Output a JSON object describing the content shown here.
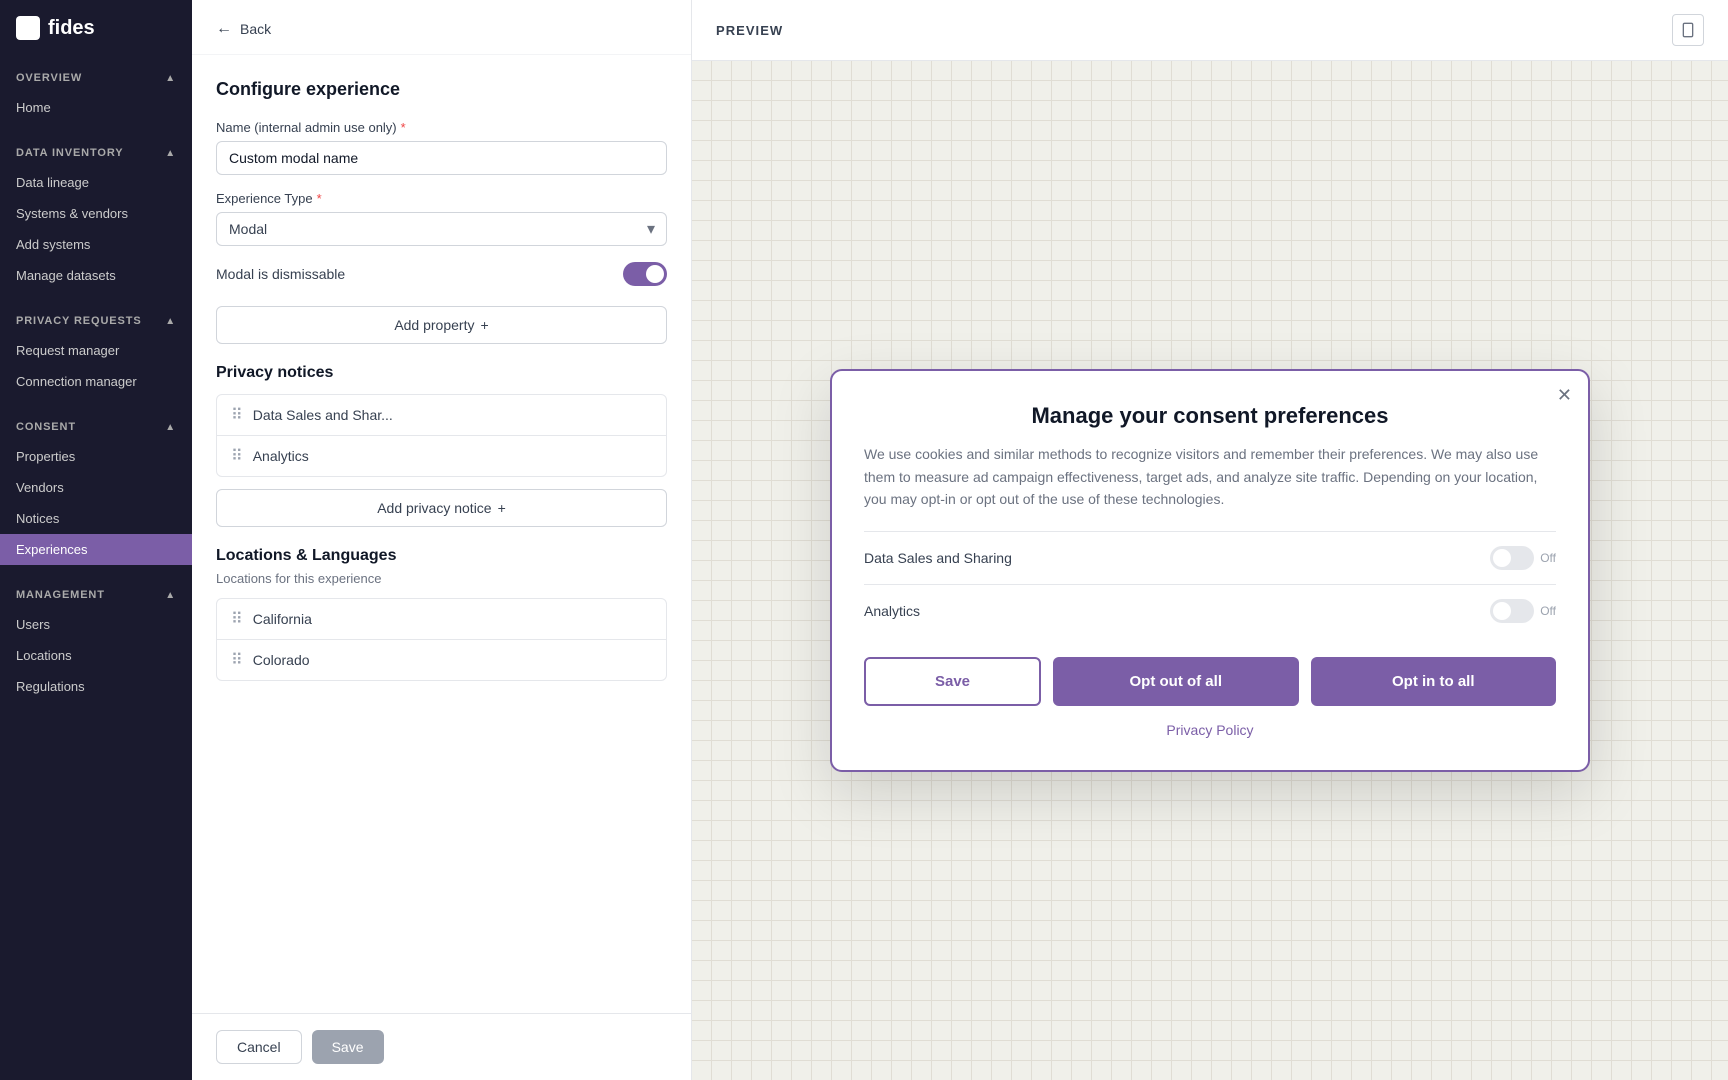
{
  "app": {
    "logo_text": "fides"
  },
  "sidebar": {
    "sections": [
      {
        "id": "overview",
        "label": "OVERVIEW",
        "items": [
          {
            "id": "home",
            "label": "Home",
            "active": false
          }
        ]
      },
      {
        "id": "data_inventory",
        "label": "DATA INVENTORY",
        "items": [
          {
            "id": "data_lineage",
            "label": "Data lineage",
            "active": false
          },
          {
            "id": "systems_vendors",
            "label": "Systems & vendors",
            "active": false
          },
          {
            "id": "add_systems",
            "label": "Add systems",
            "active": false
          },
          {
            "id": "manage_datasets",
            "label": "Manage datasets",
            "active": false
          }
        ]
      },
      {
        "id": "privacy_requests",
        "label": "PRIVACY REQUESTS",
        "items": [
          {
            "id": "request_manager",
            "label": "Request manager",
            "active": false
          },
          {
            "id": "connection_manager",
            "label": "Connection manager",
            "active": false
          }
        ]
      },
      {
        "id": "consent",
        "label": "CONSENT",
        "items": [
          {
            "id": "properties",
            "label": "Properties",
            "active": false
          },
          {
            "id": "vendors",
            "label": "Vendors",
            "active": false
          },
          {
            "id": "notices",
            "label": "Notices",
            "active": false
          },
          {
            "id": "experiences",
            "label": "Experiences",
            "active": true
          }
        ]
      },
      {
        "id": "management",
        "label": "MANAGEMENT",
        "items": [
          {
            "id": "users",
            "label": "Users",
            "active": false
          },
          {
            "id": "locations",
            "label": "Locations",
            "active": false
          },
          {
            "id": "regulations",
            "label": "Regulations",
            "active": false
          }
        ]
      }
    ]
  },
  "config": {
    "back_label": "Back",
    "section_title": "Configure experience",
    "name_label": "Name (internal admin use only)",
    "name_value": "Custom modal name",
    "experience_type_label": "Experience Type",
    "experience_type_value": "Modal",
    "modal_dismissable_label": "Modal is dismissable",
    "add_property_label": "Add property",
    "privacy_notices_title": "Privacy notices",
    "notices": [
      {
        "id": "data_sales",
        "label": "Data Sales and Shar..."
      },
      {
        "id": "analytics",
        "label": "Analytics"
      }
    ],
    "add_privacy_notice_label": "Add privacy notice",
    "locations_title": "Locations & Languages",
    "locations_subtitle": "Locations for this experience",
    "locations": [
      {
        "id": "california",
        "label": "California"
      },
      {
        "id": "colorado",
        "label": "Colorado"
      }
    ],
    "cancel_label": "Cancel",
    "save_label": "Save"
  },
  "preview": {
    "title": "PREVIEW",
    "modal": {
      "title": "Manage your consent preferences",
      "description": "We use cookies and similar methods to recognize visitors and remember their preferences. We may also use them to measure ad campaign effectiveness, target ads, and analyze site traffic. Depending on your location, you may opt-in or opt out of the use of these technologies.",
      "items": [
        {
          "id": "data_sales",
          "label": "Data Sales and Sharing",
          "state": "Off"
        },
        {
          "id": "analytics",
          "label": "Analytics",
          "state": "Off"
        }
      ],
      "save_label": "Save",
      "opt_out_label": "Opt out of all",
      "opt_in_label": "Opt in to all",
      "privacy_policy_label": "Privacy Policy"
    }
  }
}
